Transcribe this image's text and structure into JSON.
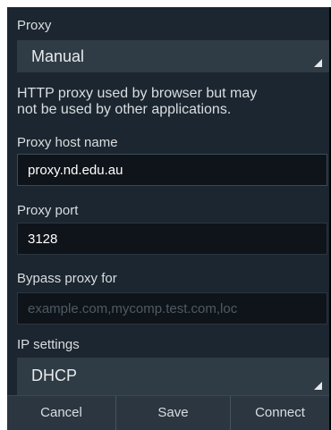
{
  "proxy": {
    "label": "Proxy",
    "selected": "Manual"
  },
  "info_text": {
    "line1": "HTTP proxy used by browser but may",
    "line2": "not be used by other applications."
  },
  "host": {
    "label": "Proxy host name",
    "value": "proxy.nd.edu.au"
  },
  "port": {
    "label": "Proxy port",
    "value": "3128"
  },
  "bypass": {
    "label": "Bypass proxy for",
    "placeholder": "example.com,mycomp.test.com,loc"
  },
  "ip_settings": {
    "label": "IP settings",
    "selected": "DHCP"
  },
  "buttons": {
    "cancel": "Cancel",
    "save": "Save",
    "connect": "Connect"
  },
  "colors": {
    "dialog_background": "#1c2630",
    "spinner_background": "#2f3b45",
    "field_background": "#0f141a",
    "text_primary": "#d9dde0",
    "placeholder_text": "#4f5a64"
  },
  "icons": {
    "spinner_indicator": "dropdown-corner-triangle-icon"
  }
}
